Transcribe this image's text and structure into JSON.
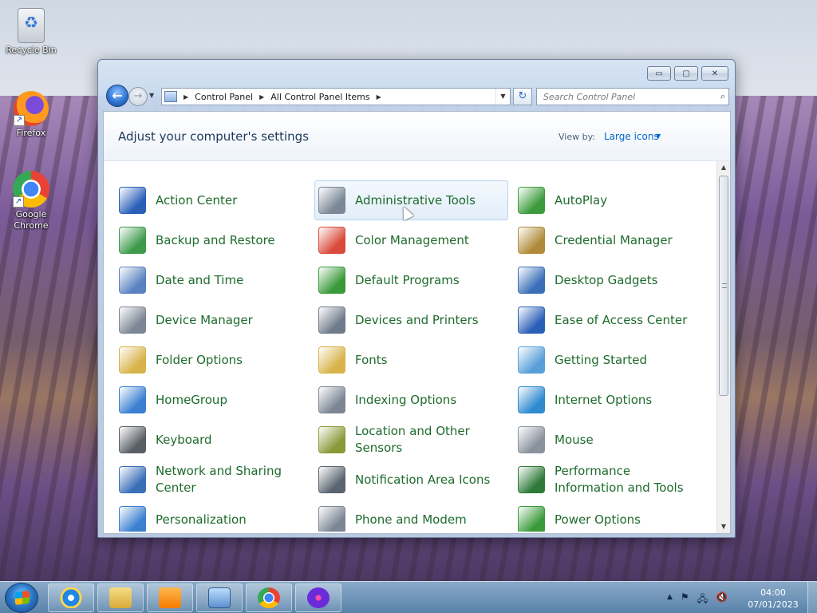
{
  "desktop": {
    "icons": [
      {
        "label": "Recycle Bin",
        "icon": "recycle-bin-icon"
      },
      {
        "label": "Firefox",
        "icon": "firefox-icon"
      },
      {
        "label": "Google Chrome",
        "icon": "chrome-icon"
      }
    ]
  },
  "window": {
    "buttons": {
      "minimize": "▭",
      "maximize": "▢",
      "close": "✕"
    },
    "nav": {
      "back": "←",
      "forward": "→",
      "history": "▼"
    },
    "address": {
      "crumbs": [
        "Control Panel",
        "All Control Panel Items"
      ],
      "separator": "▶",
      "dropdown": "▼"
    },
    "refresh": "↻",
    "search": {
      "placeholder": "Search Control Panel",
      "icon": "⌕"
    }
  },
  "content": {
    "heading": "Adjust your computer's settings",
    "view_by_label": "View by:",
    "view_by_value": "Large icons",
    "view_by_caret": "▼",
    "items": [
      {
        "label": "Action Center",
        "icon": "flag-icon",
        "color": "#2a5fb8"
      },
      {
        "label": "Administrative Tools",
        "icon": "admin-tools-icon",
        "color": "#7a8796"
      },
      {
        "label": "AutoPlay",
        "icon": "autoplay-icon",
        "color": "#3c9b3c"
      },
      {
        "label": "Backup and Restore",
        "icon": "backup-icon",
        "color": "#3d9a4a"
      },
      {
        "label": "Color Management",
        "icon": "color-management-icon",
        "color": "#d94a3a"
      },
      {
        "label": "Credential Manager",
        "icon": "credential-icon",
        "color": "#b08a3a"
      },
      {
        "label": "Date and Time",
        "icon": "clock-icon",
        "color": "#5a82c0"
      },
      {
        "label": "Default Programs",
        "icon": "default-programs-icon",
        "color": "#3a9a3a"
      },
      {
        "label": "Desktop Gadgets",
        "icon": "gadgets-icon",
        "color": "#3a6fb8"
      },
      {
        "label": "Device Manager",
        "icon": "device-manager-icon",
        "color": "#7c8694"
      },
      {
        "label": "Devices and Printers",
        "icon": "printer-icon",
        "color": "#6f7b8a"
      },
      {
        "label": "Ease of Access Center",
        "icon": "ease-of-access-icon",
        "color": "#2a5fb8"
      },
      {
        "label": "Folder Options",
        "icon": "folder-icon",
        "color": "#d8b34a"
      },
      {
        "label": "Fonts",
        "icon": "fonts-icon",
        "color": "#d8b34a"
      },
      {
        "label": "Getting Started",
        "icon": "getting-started-icon",
        "color": "#5aa0d8"
      },
      {
        "label": "HomeGroup",
        "icon": "homegroup-icon",
        "color": "#3a7fd0"
      },
      {
        "label": "Indexing Options",
        "icon": "indexing-icon",
        "color": "#7c8694"
      },
      {
        "label": "Internet Options",
        "icon": "internet-options-icon",
        "color": "#2f8ad0"
      },
      {
        "label": "Keyboard",
        "icon": "keyboard-icon",
        "color": "#5a5f66"
      },
      {
        "label": "Location and Other Sensors",
        "icon": "sensors-icon",
        "color": "#8a9a3a"
      },
      {
        "label": "Mouse",
        "icon": "mouse-icon",
        "color": "#8a929c"
      },
      {
        "label": "Network and Sharing Center",
        "icon": "network-icon",
        "color": "#3a6fb8"
      },
      {
        "label": "Notification Area Icons",
        "icon": "notification-icon",
        "color": "#5a6470"
      },
      {
        "label": "Performance Information and Tools",
        "icon": "performance-icon",
        "color": "#2f7a3a"
      },
      {
        "label": "Personalization",
        "icon": "personalization-icon",
        "color": "#3a7fd0"
      },
      {
        "label": "Phone and Modem",
        "icon": "phone-icon",
        "color": "#7c8694"
      },
      {
        "label": "Power Options",
        "icon": "power-icon",
        "color": "#3a9a3a"
      }
    ],
    "scroll": {
      "up": "▲",
      "down": "▼"
    }
  },
  "taskbar": {
    "apps": [
      "internet-explorer-icon",
      "explorer-icon",
      "media-player-icon",
      "control-panel-icon",
      "chrome-icon",
      "app-icon"
    ],
    "tray": {
      "show_hidden": "▲",
      "flag": "⚑",
      "network": "🖧",
      "volume": "🔇"
    },
    "clock": {
      "time": "04:00",
      "date": "07/01/2023"
    }
  }
}
